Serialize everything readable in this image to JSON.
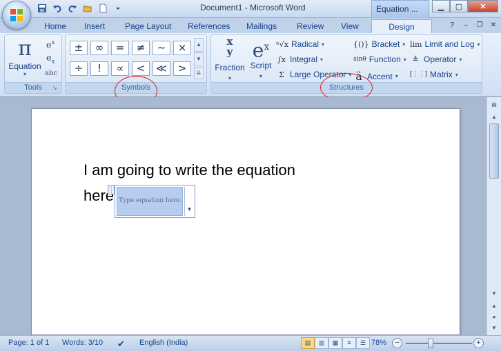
{
  "title_bar": {
    "title": "Document1 - Microsoft Word",
    "context_tab_title": "Equation ...",
    "controls": [
      "minimize-icon",
      "maximize-icon",
      "close-icon"
    ]
  },
  "quick_access": [
    "save-icon",
    "undo-icon",
    "redo-icon",
    "open-icon",
    "new-icon",
    "customize-icon"
  ],
  "tabs": [
    "Home",
    "Insert",
    "Page Layout",
    "References",
    "Mailings",
    "Review",
    "View",
    "Design"
  ],
  "active_tab": "Design",
  "ribbon": {
    "tools": {
      "label": "Tools",
      "equation_label": "Equation",
      "equation_glyph": "π"
    },
    "symbols": {
      "label": "Symbols",
      "row1": [
        "±",
        "∞",
        "=",
        "≠",
        "~",
        "×"
      ],
      "row2": [
        "÷",
        "!",
        "∝",
        "<",
        "≪",
        ">"
      ]
    },
    "structures": {
      "label": "Structures",
      "fraction_label": "Fraction",
      "script_label": "Script",
      "radical_label": "Radical",
      "integral_label": "Integral",
      "large_operator_label": "Large Operator",
      "bracket_label": "Bracket",
      "function_label": "Function",
      "accent_label": "Accent",
      "limit_log_label": "Limit and Log",
      "operator_label": "Operator",
      "matrix_label": "Matrix"
    }
  },
  "document": {
    "line1": "I am going to write the equation",
    "line2": "here",
    "equation_placeholder": "Type equation here."
  },
  "status_bar": {
    "page": "Page: 1 of 1",
    "words": "Words: 3/10",
    "language": "English (India)",
    "zoom": "78%"
  },
  "colors": {
    "ribbon_bg": "#dbe7f6",
    "accent_text": "#15428b",
    "annotation_red": "#d42020",
    "equation_field": "#b6cdf0"
  }
}
